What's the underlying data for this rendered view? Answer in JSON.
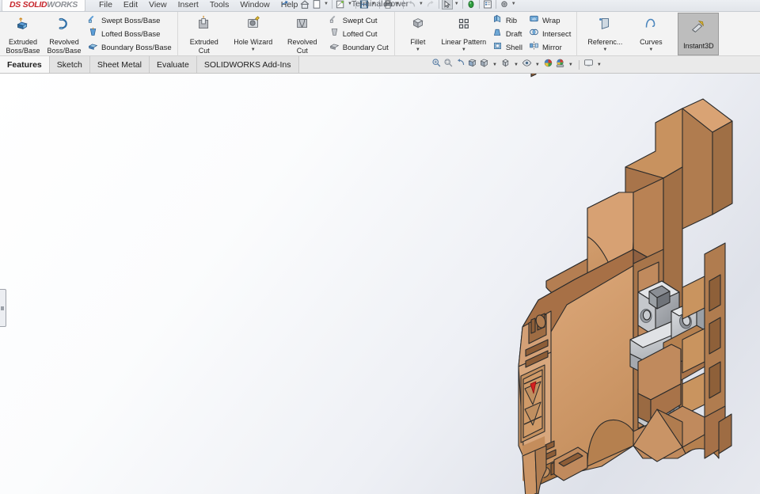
{
  "window": {
    "title": "Terminal Power",
    "logo_primary": "SOLID",
    "logo_secondary": "WORKS",
    "logo_prefix": "DS",
    "minimize": "–",
    "maximize": "□",
    "close": "×"
  },
  "menu": {
    "items": [
      {
        "label": "File",
        "name": "menu-file"
      },
      {
        "label": "Edit",
        "name": "menu-edit"
      },
      {
        "label": "View",
        "name": "menu-view"
      },
      {
        "label": "Insert",
        "name": "menu-insert"
      },
      {
        "label": "Tools",
        "name": "menu-tools"
      },
      {
        "label": "Window",
        "name": "menu-window"
      },
      {
        "label": "Help",
        "name": "menu-help"
      }
    ],
    "pin_icon": "pushpin-icon"
  },
  "quick_access": {
    "icons": [
      "home-icon",
      "new-document-icon",
      "open-document-icon",
      "save-icon",
      "print-icon",
      "undo-icon",
      "redo-icon",
      "select-icon",
      "rebuild-icon",
      "file-properties-icon",
      "options-icon"
    ]
  },
  "ribbon": {
    "groups": [
      {
        "name": "boss-base-group",
        "big_buttons": [
          {
            "label": "Extruded\nBoss/Base",
            "icon": "extruded-boss-icon",
            "name": "extruded-boss-base-button"
          },
          {
            "label": "Revolved\nBoss/Base",
            "icon": "revolved-boss-icon",
            "name": "revolved-boss-base-button"
          }
        ],
        "small_buttons": [
          {
            "label": "Swept Boss/Base",
            "icon": "swept-boss-icon",
            "name": "swept-boss-base-button"
          },
          {
            "label": "Lofted Boss/Base",
            "icon": "lofted-boss-icon",
            "name": "lofted-boss-base-button"
          },
          {
            "label": "Boundary Boss/Base",
            "icon": "boundary-boss-icon",
            "name": "boundary-boss-base-button"
          }
        ]
      },
      {
        "name": "cut-group",
        "big_buttons": [
          {
            "label": "Extruded\nCut",
            "icon": "extruded-cut-icon",
            "name": "extruded-cut-button",
            "caret": false
          },
          {
            "label": "Hole Wizard",
            "icon": "hole-wizard-icon",
            "name": "hole-wizard-button",
            "caret": true
          },
          {
            "label": "Revolved\nCut",
            "icon": "revolved-cut-icon",
            "name": "revolved-cut-button",
            "caret": false
          }
        ],
        "small_buttons": [
          {
            "label": "Swept Cut",
            "icon": "swept-cut-icon",
            "name": "swept-cut-button"
          },
          {
            "label": "Lofted Cut",
            "icon": "lofted-cut-icon",
            "name": "lofted-cut-button"
          },
          {
            "label": "Boundary Cut",
            "icon": "boundary-cut-icon",
            "name": "boundary-cut-button"
          }
        ]
      },
      {
        "name": "feature-group",
        "big_buttons": [
          {
            "label": "Fillet",
            "icon": "fillet-icon",
            "name": "fillet-button",
            "caret": true
          },
          {
            "label": "Linear Pattern",
            "icon": "linear-pattern-icon",
            "name": "linear-pattern-button",
            "caret": true
          }
        ],
        "small_buttons_a": [
          {
            "label": "Rib",
            "icon": "rib-icon",
            "name": "rib-button"
          },
          {
            "label": "Draft",
            "icon": "draft-icon",
            "name": "draft-button"
          },
          {
            "label": "Shell",
            "icon": "shell-icon",
            "name": "shell-button"
          }
        ],
        "small_buttons_b": [
          {
            "label": "Wrap",
            "icon": "wrap-icon",
            "name": "wrap-button"
          },
          {
            "label": "Intersect",
            "icon": "intersect-icon",
            "name": "intersect-button"
          },
          {
            "label": "Mirror",
            "icon": "mirror-icon",
            "name": "mirror-button"
          }
        ]
      },
      {
        "name": "reference-group",
        "big_buttons": [
          {
            "label": "Referenc...",
            "icon": "reference-geometry-icon",
            "name": "reference-geometry-button",
            "caret": true
          },
          {
            "label": "Curves",
            "icon": "curves-icon",
            "name": "curves-button",
            "caret": true
          }
        ]
      }
    ],
    "instant3d": {
      "label": "Instant3D",
      "icon": "instant3d-icon",
      "name": "instant3d-button",
      "active": true
    }
  },
  "tabs": {
    "items": [
      {
        "label": "Features",
        "name": "tab-features",
        "active": true
      },
      {
        "label": "Sketch",
        "name": "tab-sketch",
        "active": false
      },
      {
        "label": "Sheet Metal",
        "name": "tab-sheet-metal",
        "active": false
      },
      {
        "label": "Evaluate",
        "name": "tab-evaluate",
        "active": false
      },
      {
        "label": "SOLIDWORKS Add-Ins",
        "name": "tab-solidworks-addins",
        "active": false
      }
    ]
  },
  "view_toolbar": {
    "icons": [
      "zoom-to-fit-icon",
      "zoom-to-area-icon",
      "previous-view-icon",
      "section-view-icon",
      "view-orientation-icon",
      "display-style-icon",
      "hide-show-items-icon",
      "edit-appearance-icon",
      "apply-scene-icon",
      "view-settings-icon"
    ]
  },
  "graphics": {
    "background_top": "#ffffff",
    "background_bottom": "#dee1e9",
    "feature_manager_tab": "feature-manager-flyout-tab"
  },
  "model": {
    "name": "terminal-power-block-model",
    "description": "Isometric shaded 3D CAD model of a sectioned DIN-rail terminal power block",
    "colors": {
      "plastic_light": "#dda87a",
      "plastic_mid": "#c08a5d",
      "plastic_dark": "#9a6a42",
      "plastic_shadow": "#865b38",
      "metal_light": "#d7d9dc",
      "metal_mid": "#b3b6bb",
      "metal_dark": "#8f9399",
      "highlight_red": "#d41f1f",
      "edge": "#2a2a2a"
    }
  }
}
